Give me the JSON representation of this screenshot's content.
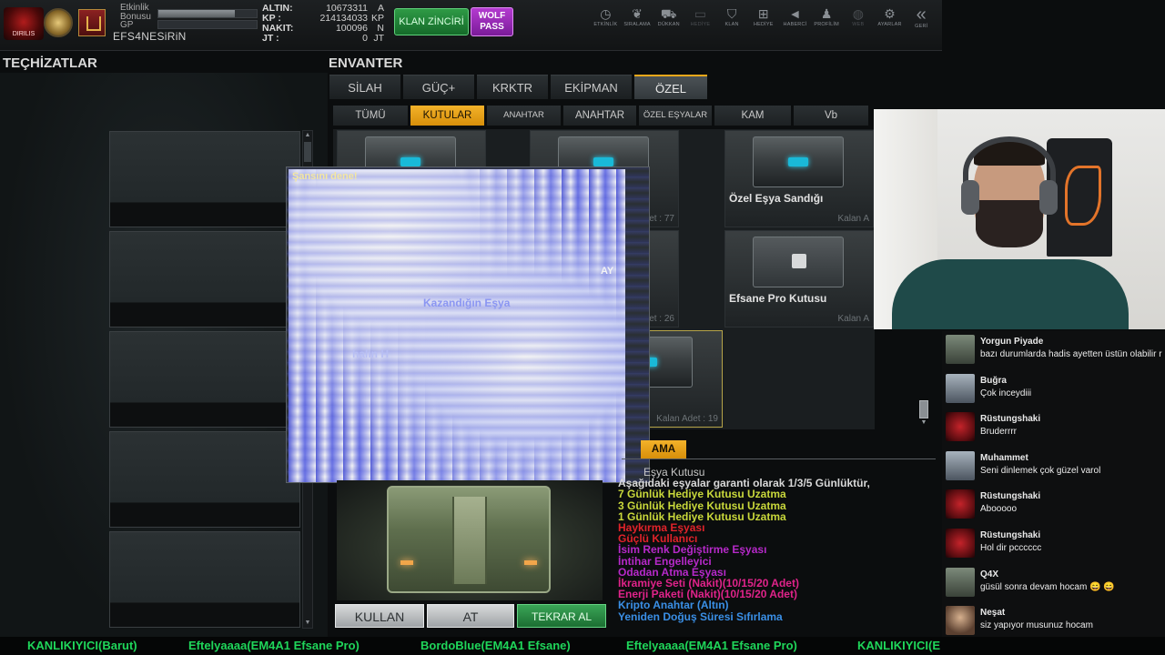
{
  "hud": {
    "logo_text": "DIRILIS",
    "etkinlik_label": "Etkinlik Bonusu",
    "gp_label": "GP",
    "username": "EFS4NESiRiN",
    "etkinlik_progress": 0.78,
    "gp_progress": 0.0,
    "resources": [
      {
        "key": "ALTIN:",
        "value": "10673311",
        "unit": "A"
      },
      {
        "key": "KP :",
        "value": "214134033",
        "unit": "KP"
      },
      {
        "key": "NAKIT:",
        "value": "100096",
        "unit": "N"
      },
      {
        "key": "JT :",
        "value": "0",
        "unit": "JT"
      }
    ],
    "klan_button": "KLAN ZİNCİRİ",
    "wolf_button": "WOLF PASS",
    "nav": [
      {
        "icon": "clock-icon",
        "label": "ETKİNLİK",
        "enabled": true
      },
      {
        "icon": "wolf-icon",
        "label": "SIRALAMA",
        "enabled": true
      },
      {
        "icon": "cart-icon",
        "label": "DÜKKAN",
        "enabled": true
      },
      {
        "icon": "gift-box-icon",
        "label": "HEDİYE",
        "enabled": false
      },
      {
        "icon": "shield-icon",
        "label": "KLAN",
        "enabled": true
      },
      {
        "icon": "present-icon",
        "label": "HEDİYE",
        "enabled": true
      },
      {
        "icon": "megaphone-icon",
        "label": "HABERCİ",
        "enabled": true
      },
      {
        "icon": "profile-icon",
        "label": "PROFİLİM",
        "enabled": true
      },
      {
        "icon": "web-icon",
        "label": "WEB",
        "enabled": false
      },
      {
        "icon": "gear-icon",
        "label": "AYARLAR",
        "enabled": true
      },
      {
        "icon": "back-icon",
        "label": "GERİ",
        "enabled": true
      }
    ]
  },
  "equipment": {
    "title": "TEÇHİZATLAR"
  },
  "inventory": {
    "title": "ENVANTER",
    "tabs": [
      "SİLAH",
      "GÜÇ+",
      "KRKTR",
      "EKİPMAN",
      "ÖZEL"
    ],
    "subtabs": [
      "TÜMÜ",
      "KUTULAR",
      "ANAHTAR KUTUSU",
      "ANAHTAR",
      "ÖZEL EŞYALAR",
      "KAM",
      "Vb"
    ],
    "cards": [
      {
        "name": "Özel Eşya Sandığı",
        "count": "Kalan A"
      },
      {
        "name": "",
        "count": "Kalan Adet : 77"
      },
      {
        "name": "Efsane Pro Kutusu",
        "count": "Kalan A"
      },
      {
        "name": "",
        "count": "Kalan Adet : 26"
      },
      {
        "name": "",
        "count": "Kalan Adet : 19"
      }
    ],
    "overlay": {
      "top_text": "Şansını dene!",
      "mid_text": "Kazandığın Eşya",
      "low_text": "halin H",
      "side_text": "AY"
    },
    "description": {
      "tag": "AMA",
      "title": "Eşya Kutusu",
      "lines": [
        {
          "text": "Aşağıdaki eşyalar garanti olarak 1/3/5 Günlüktür,",
          "color": "#d8d8d8"
        },
        {
          "text": "7 Günlük Hediye Kutusu Uzatma",
          "color": "#c9d83b"
        },
        {
          "text": "3 Günlük Hediye Kutusu Uzatma",
          "color": "#c9d83b"
        },
        {
          "text": "1 Günlük Hediye Kutusu Uzatma",
          "color": "#c9d83b"
        },
        {
          "text": "Haykırma Eşyası",
          "color": "#e0232a"
        },
        {
          "text": "Güçlü Kullanıcı",
          "color": "#e0232a"
        },
        {
          "text": "İsim Renk Değiştirme Eşyası",
          "color": "#b629c9"
        },
        {
          "text": "İntihar Engelleyici",
          "color": "#b629c9"
        },
        {
          "text": "Odadan Atma Eşyası",
          "color": "#b629c9"
        },
        {
          "text": "İkramiye Seti (Nakit)(10/15/20 Adet)",
          "color": "#e0238a"
        },
        {
          "text": "Enerji Paketi (Nakit)(10/15/20 Adet)",
          "color": "#e0238a"
        },
        {
          "text": "Kripto Anahtar (Altın)",
          "color": "#3a8fe6"
        },
        {
          "text": "Yeniden Doğuş Süresi Sıfırlama",
          "color": "#3a8fe6"
        }
      ]
    },
    "buttons": {
      "use": "KULLAN",
      "drop": "AT",
      "rebuy": "TEKRAR AL"
    }
  },
  "chat": [
    {
      "user": "Yorgun Piyade",
      "text": "bazı durumlarda hadis ayetten üstün olabilir r",
      "avatar": "cam"
    },
    {
      "user": "Buğra",
      "text": "Çok inceydiii",
      "avatar": "photo"
    },
    {
      "user": "Rüstungshaki",
      "text": "Bruderrrr",
      "avatar": "red"
    },
    {
      "user": "Muhammet",
      "text": "Seni dinlemek çok güzel varol",
      "avatar": "photo"
    },
    {
      "user": "Rüstungshaki",
      "text": "Abooooo",
      "avatar": "red"
    },
    {
      "user": "Rüstungshaki",
      "text": "Hol dir pcccccc",
      "avatar": "red"
    },
    {
      "user": "Q4X",
      "text": "güsül sonra devam hocam 😄 😄",
      "avatar": "cam"
    },
    {
      "user": "Neşat",
      "text": "siz yapıyor musunuz hocam",
      "avatar": "face"
    }
  ],
  "ticker": [
    "KANLIKIYICI(Barut)",
    "Eftelyaaaa(EM4A1 Efsane Pro)",
    "BordoBlue(EM4A1 Efsane)",
    "Eftelyaaaa(EM4A1 Efsane Pro)",
    "KANLIKIYICI(E"
  ]
}
